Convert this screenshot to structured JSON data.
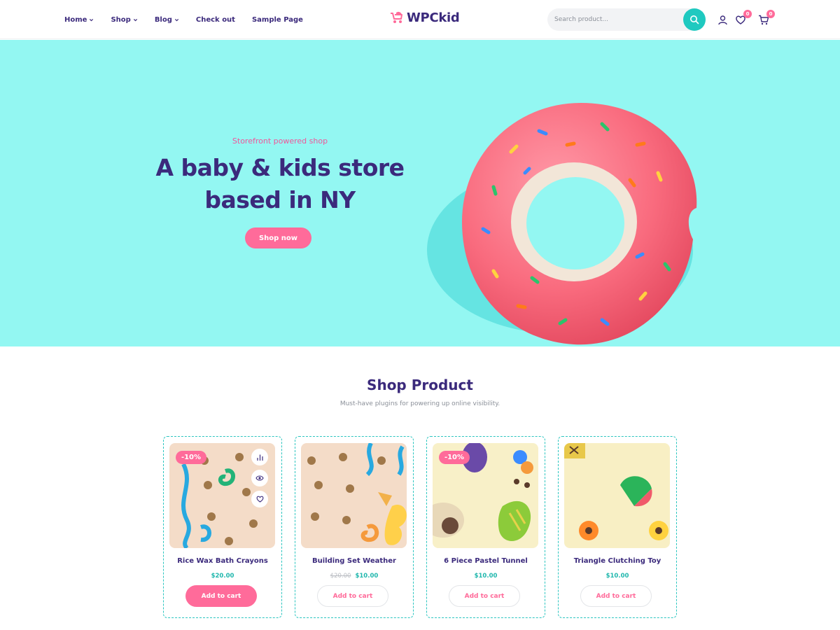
{
  "nav": {
    "items": [
      {
        "label": "Home",
        "dropdown": true
      },
      {
        "label": "Shop",
        "dropdown": true
      },
      {
        "label": "Blog",
        "dropdown": true
      },
      {
        "label": "Check out",
        "dropdown": false
      },
      {
        "label": "Sample Page",
        "dropdown": false
      }
    ]
  },
  "logo": {
    "text": "WPCkid",
    "icon": "stroller-icon"
  },
  "search": {
    "placeholder": "Search product...",
    "icon": "search-icon"
  },
  "header_icons": {
    "account_icon": "user-icon",
    "wishlist_icon": "heart-icon",
    "wishlist_count": "0",
    "cart_icon": "cart-icon",
    "cart_count": "0"
  },
  "hero": {
    "subtitle": "Storefront powered shop",
    "title_line1": "A baby & kids store",
    "title_line2": "based in NY",
    "button_label": "Shop now"
  },
  "shop": {
    "title": "Shop Product",
    "subtitle": "Must-have plugins for powering up online visibility.",
    "products": [
      {
        "name": "Rice Wax Bath Crayons",
        "price": "$20.00",
        "old_price": "",
        "badge": "-10%",
        "button": "Add to cart",
        "hover_actions": [
          "compare-icon",
          "eye-icon",
          "heart-icon"
        ]
      },
      {
        "name": "Building Set Weather",
        "price": "$10.00",
        "old_price": "$20.00",
        "badge": "",
        "button": "Add to cart"
      },
      {
        "name": "6 Piece Pastel Tunnel",
        "price": "$10.00",
        "old_price": "",
        "badge": "-10%",
        "button": "Add to cart"
      },
      {
        "name": "Triangle Clutching Toy",
        "price": "$10.00",
        "old_price": "",
        "badge": "",
        "button": "Add to cart"
      }
    ]
  },
  "colors": {
    "brand_purple": "#3b2a7c",
    "accent_pink": "#ff6b9a",
    "accent_teal": "#1fc9c0",
    "hero_bg": "#93f7f2"
  }
}
